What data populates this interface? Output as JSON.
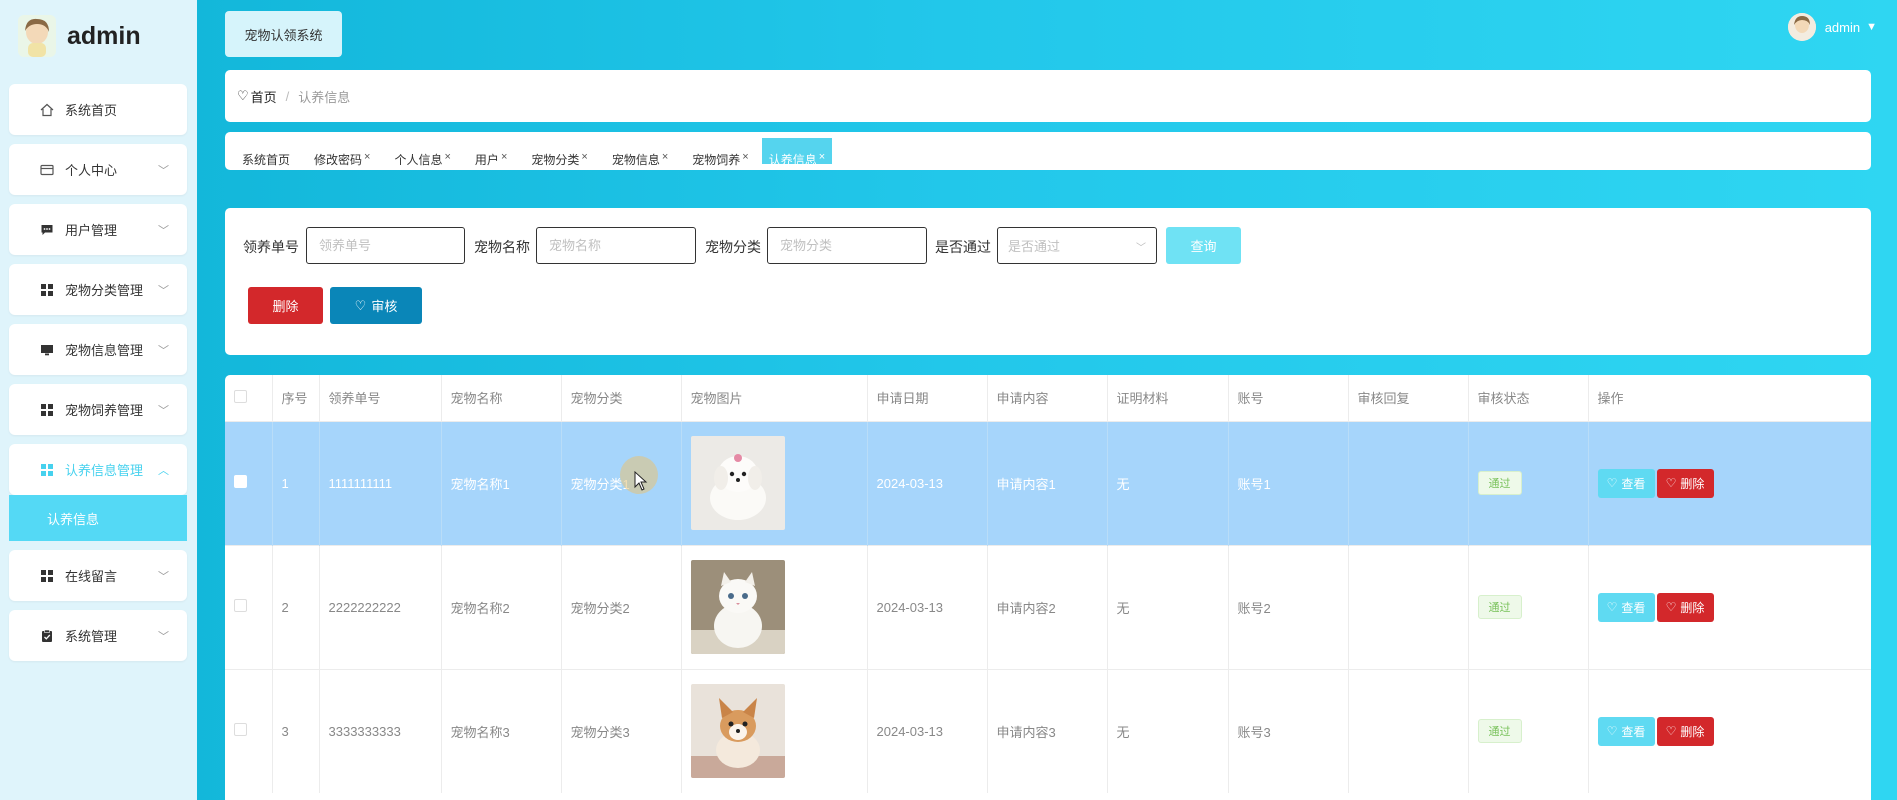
{
  "user": {
    "name": "admin"
  },
  "sidebar": {
    "items": [
      {
        "label": "系统首页",
        "icon": "home-icon"
      },
      {
        "label": "个人中心",
        "icon": "card-icon"
      },
      {
        "label": "用户管理",
        "icon": "chat-icon"
      },
      {
        "label": "宠物分类管理",
        "icon": "grid-icon"
      },
      {
        "label": "宠物信息管理",
        "icon": "monitor-icon"
      },
      {
        "label": "宠物饲养管理",
        "icon": "grid-icon"
      },
      {
        "label": "认养信息管理",
        "icon": "grid-icon"
      },
      {
        "label": "在线留言",
        "icon": "grid-icon"
      },
      {
        "label": "系统管理",
        "icon": "clipboard-icon"
      }
    ],
    "sub_item": "认养信息"
  },
  "top": {
    "system_title": "宠物认领系统"
  },
  "breadcrumb": {
    "home": "首页",
    "separator": "/",
    "current": "认养信息"
  },
  "tabs": [
    {
      "label": "系统首页"
    },
    {
      "label": "修改密码"
    },
    {
      "label": "个人信息"
    },
    {
      "label": "用户"
    },
    {
      "label": "宠物分类"
    },
    {
      "label": "宠物信息"
    },
    {
      "label": "宠物饲养"
    },
    {
      "label": "认养信息"
    }
  ],
  "search": {
    "fields": [
      {
        "label": "领养单号",
        "placeholder": "领养单号"
      },
      {
        "label": "宠物名称",
        "placeholder": "宠物名称"
      },
      {
        "label": "宠物分类",
        "placeholder": "宠物分类"
      },
      {
        "label": "是否通过",
        "placeholder": "是否通过"
      }
    ],
    "query_label": "查询",
    "delete_label": "删除",
    "audit_label": "审核"
  },
  "table": {
    "headers": [
      "序号",
      "领养单号",
      "宠物名称",
      "宠物分类",
      "宠物图片",
      "申请日期",
      "申请内容",
      "证明材料",
      "账号",
      "审核回复",
      "审核状态",
      "操作"
    ],
    "rows": [
      {
        "index": "1",
        "order": "1111111111",
        "name": "宠物名称1",
        "category": "宠物分类1",
        "date": "2024-03-13",
        "content": "申请内容1",
        "proof": "无",
        "account": "账号1",
        "reply": "",
        "status": "通过"
      },
      {
        "index": "2",
        "order": "2222222222",
        "name": "宠物名称2",
        "category": "宠物分类2",
        "date": "2024-03-13",
        "content": "申请内容2",
        "proof": "无",
        "account": "账号2",
        "reply": "",
        "status": "通过"
      },
      {
        "index": "3",
        "order": "3333333333",
        "name": "宠物名称3",
        "category": "宠物分类3",
        "date": "2024-03-13",
        "content": "申请内容3",
        "proof": "无",
        "account": "账号3",
        "reply": "",
        "status": "通过"
      }
    ],
    "view_label": "查看",
    "delete_label": "删除"
  },
  "colors": {
    "accent": "#46d1ee",
    "danger": "#d3282b",
    "primary": "#0a86b8",
    "selected_row": "#a6d5fb"
  }
}
